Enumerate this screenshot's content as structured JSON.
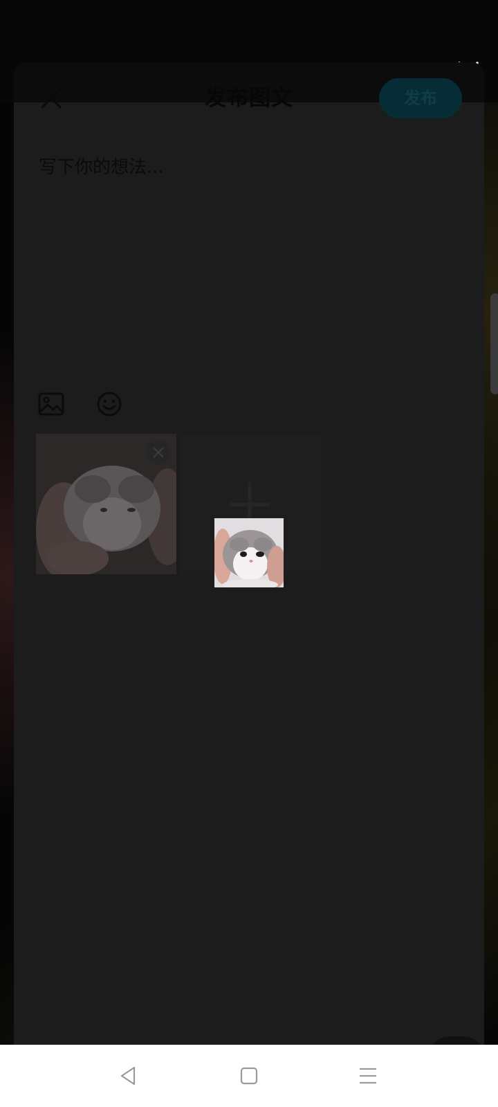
{
  "sheet": {
    "title": "发布图文",
    "publish_label": "发布",
    "text_placeholder": "写下你的想法..."
  },
  "toolbar": {
    "icons": [
      "image-icon",
      "emoji-icon"
    ]
  },
  "media": {
    "selected_count": 1,
    "add_icon": "plus-icon",
    "remove_icon": "close-icon"
  },
  "navbar": {
    "icons": [
      "back-icon",
      "home-icon",
      "menu-icon"
    ]
  },
  "colors": {
    "sheet_bg": "#1c1c1d",
    "publish_bg": "#062c35",
    "navbar_bg": "#ffffff"
  }
}
